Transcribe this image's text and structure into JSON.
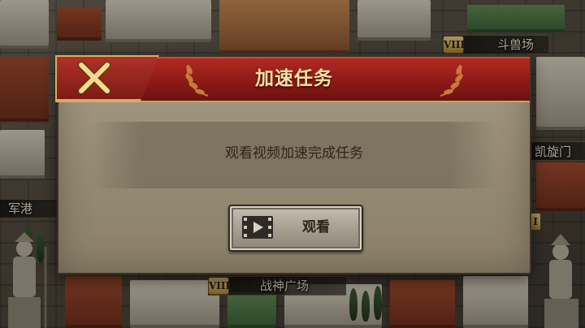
{
  "map": {
    "labels": {
      "colosseum": "斗兽场",
      "arch": "凯旋门",
      "harbor": "军港",
      "campus_martius": "战神广场"
    },
    "numerals": {
      "colosseum": "VIII",
      "campus_martius": "VIII",
      "right_edge": "I"
    }
  },
  "dialog": {
    "title": "加速任务",
    "message": "观看视频加速完成任务",
    "watch_button_label": "观看",
    "close_icon": "close-x-icon",
    "watch_icon": "film-play-icon"
  },
  "colors": {
    "header_red": "#8e1a16",
    "title_gold": "#f7e3a6",
    "panel_stone": "#968b74",
    "gold_trim": "#d4ad60"
  }
}
